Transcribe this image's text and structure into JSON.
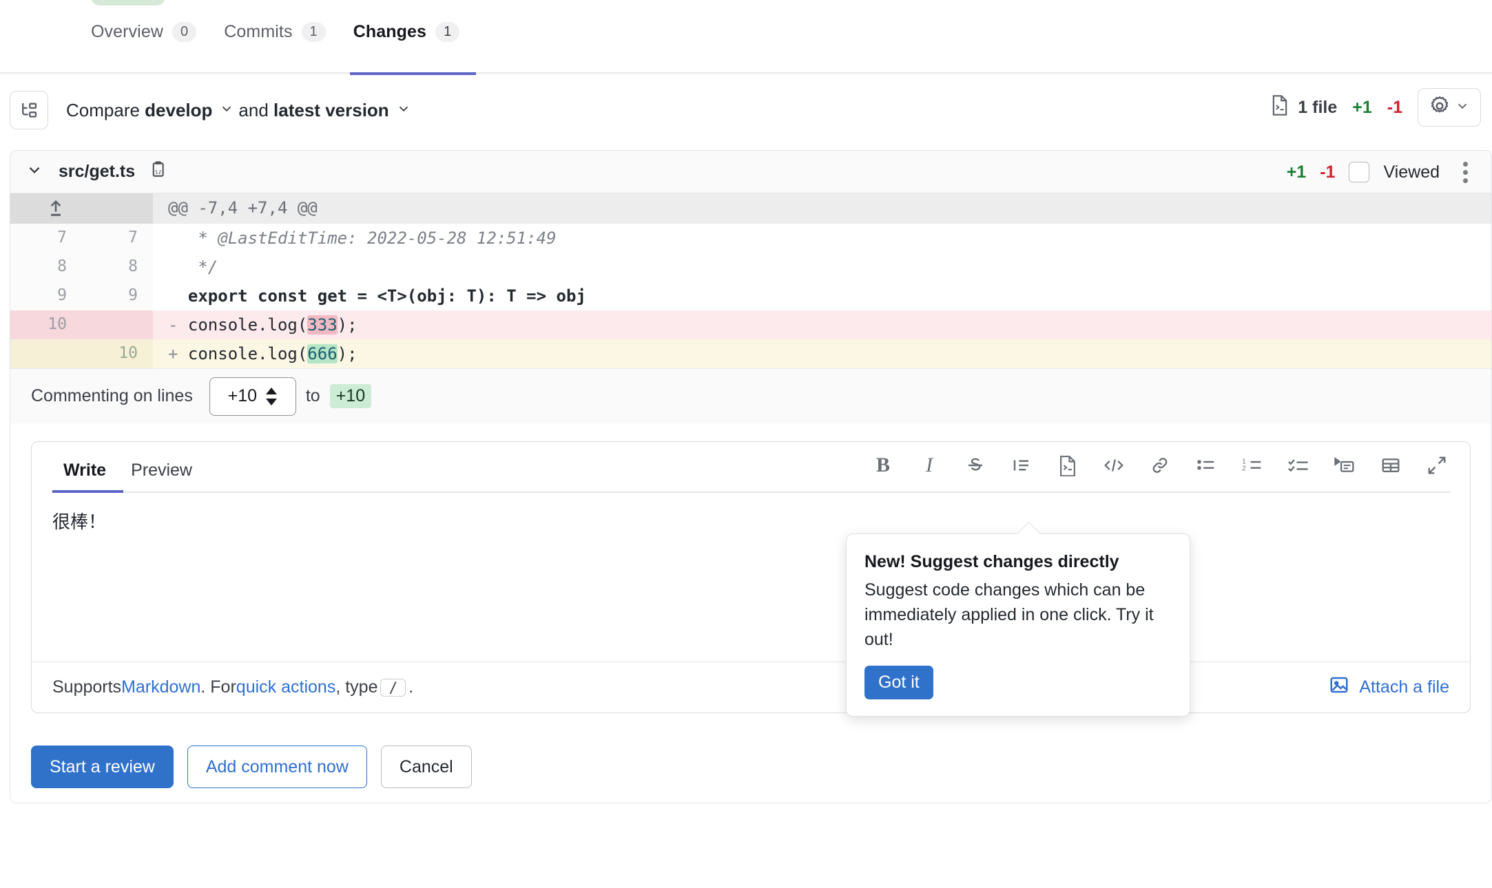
{
  "tabs": [
    {
      "label": "Overview",
      "count": "0",
      "active": false
    },
    {
      "label": "Commits",
      "count": "1",
      "active": false
    },
    {
      "label": "Changes",
      "count": "1",
      "active": true
    }
  ],
  "compare": {
    "icon": "compare-branches-icon",
    "prefix": "Compare",
    "base": "develop",
    "conjunction": "and",
    "head": "latest version",
    "file_count": "1 file",
    "additions": "+1",
    "deletions": "-1",
    "settings_icon": "gear-icon"
  },
  "file": {
    "name": "src/get.ts",
    "copy_icon": "copy-path-icon",
    "additions": "+1",
    "deletions": "-1",
    "viewed_label": "Viewed",
    "viewed_checked": false,
    "menu_icon": "kebab-menu-icon"
  },
  "diff": {
    "hunk_header": "@@ -7,4 +7,4 @@",
    "expand_icon": "expand-up-icon",
    "rows": [
      {
        "type": "ctx",
        "old": "7",
        "new": "7",
        "sign": "",
        "code": " * @LastEditTime: 2022-05-28 12:51:49"
      },
      {
        "type": "ctx",
        "old": "8",
        "new": "8",
        "sign": "",
        "code": " */"
      },
      {
        "type": "ctx",
        "old": "9",
        "new": "9",
        "sign": "",
        "code": "export const get = <T>(obj: T): T => obj"
      },
      {
        "type": "del",
        "old": "10",
        "new": "",
        "sign": "-",
        "code": "console.log(333);",
        "highlight": "333"
      },
      {
        "type": "add",
        "old": "",
        "new": "10",
        "sign": "+",
        "code": "console.log(666);",
        "highlight": "666"
      }
    ]
  },
  "commenting": {
    "label": "Commenting on lines",
    "from_value": "+10",
    "to_label": "to",
    "to_value": "+10"
  },
  "editor": {
    "tabs": [
      {
        "label": "Write",
        "active": true
      },
      {
        "label": "Preview",
        "active": false
      }
    ],
    "toolbar": [
      {
        "name": "bold-icon",
        "glyph": "B"
      },
      {
        "name": "italic-icon",
        "glyph": "I"
      },
      {
        "name": "strikethrough-icon",
        "glyph": "S"
      },
      {
        "name": "quote-icon",
        "glyph": ""
      },
      {
        "name": "suggest-changes-icon",
        "glyph": ""
      },
      {
        "name": "code-icon",
        "glyph": ""
      },
      {
        "name": "link-icon",
        "glyph": ""
      },
      {
        "name": "bulleted-list-icon",
        "glyph": ""
      },
      {
        "name": "numbered-list-icon",
        "glyph": ""
      },
      {
        "name": "task-list-icon",
        "glyph": ""
      },
      {
        "name": "mention-icon",
        "glyph": ""
      },
      {
        "name": "table-icon",
        "glyph": ""
      },
      {
        "name": "fullscreen-icon",
        "glyph": ""
      }
    ],
    "comment_text": "很棒！",
    "placeholder": "",
    "footer": {
      "prefix": "Supports ",
      "markdown_link": "Markdown",
      "middle": ". For ",
      "quick_actions_link": "quick actions",
      "type_text": ", type ",
      "slash_key": "/",
      "suffix": ".",
      "attach_label": "Attach a file",
      "attach_icon": "image-attach-icon"
    }
  },
  "popover": {
    "title": "New! Suggest changes directly",
    "body": "Suggest code changes which can be immediately applied in one click. Try it out!",
    "button": "Got it"
  },
  "actions": [
    {
      "label": "Start a review",
      "style": "primary"
    },
    {
      "label": "Add comment now",
      "style": "outline"
    },
    {
      "label": "Cancel",
      "style": "plain"
    }
  ],
  "colors": {
    "accent": "#5b64c5",
    "link": "#2f6fd0",
    "primary_button": "#3071ca",
    "addition": "#1a7f37",
    "deletion": "#cf222e"
  }
}
